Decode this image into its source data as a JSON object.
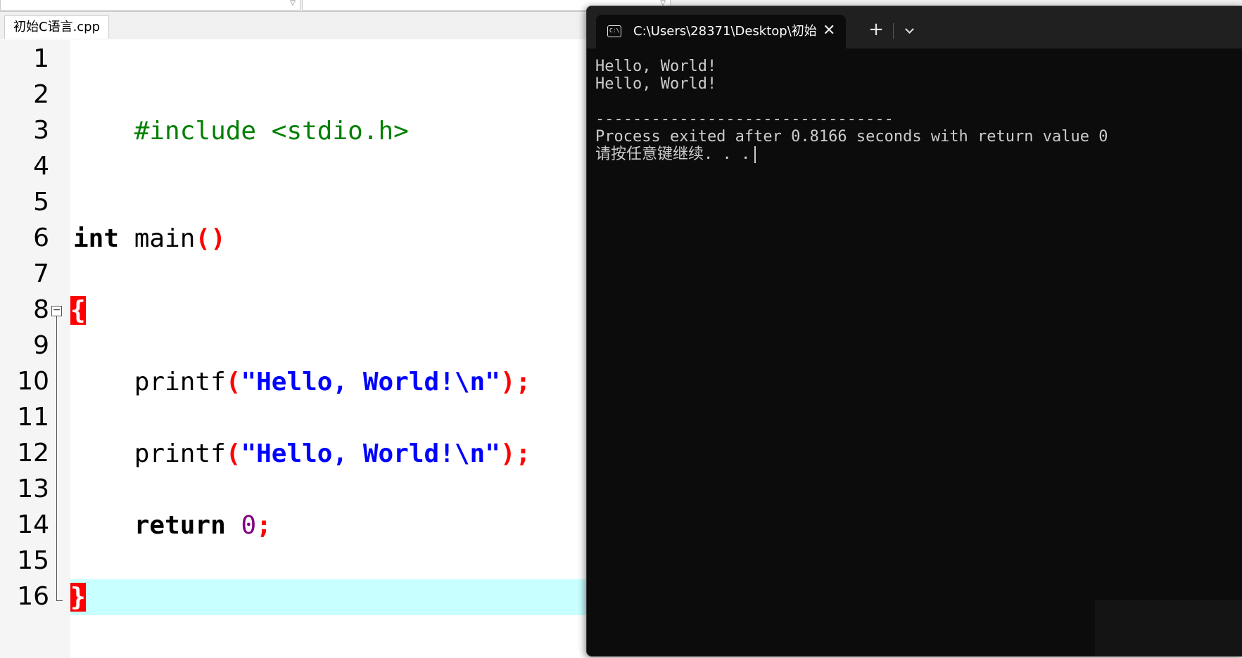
{
  "ide": {
    "file_tab": "初始C语言.cpp",
    "line_numbers": [
      "1",
      "2",
      "3",
      "4",
      "5",
      "6",
      "7",
      "8",
      "9",
      "10",
      "11",
      "12",
      "13",
      "14",
      "15",
      "16"
    ],
    "code": {
      "l2_include": "#include <stdio.h>",
      "l6_type": "int",
      "l6_name": " main",
      "l6_parens": "()",
      "l8_open_brace": "{",
      "l10_func": "printf",
      "l10_open": "(",
      "l10_str": "\"Hello, World!\\n\"",
      "l10_close": ");",
      "l12_func": "printf",
      "l12_open": "(",
      "l12_str": "\"Hello, World!\\n\"",
      "l12_close": ");",
      "l14_kw": "return",
      "l14_num": "0",
      "l14_semi": ";",
      "l16_close_brace": "}"
    },
    "fold_symbol": "−",
    "colors": {
      "preprocessor": "#008000",
      "string": "#0000ff",
      "number": "#800080",
      "symbol": "#ff0000",
      "brace_match_bg": "#ff0000",
      "current_line": "#c8ffff"
    }
  },
  "terminal": {
    "tab_icon": "terminal-icon",
    "tab_icon_text": "C:\\",
    "tab_title": "C:\\Users\\28371\\Desktop\\初始",
    "close_glyph": "✕",
    "new_tab_glyph": "+",
    "output": [
      "Hello, World!",
      "Hello, World!",
      "",
      "--------------------------------",
      "Process exited after 0.8166 seconds with return value 0",
      "请按任意键继续. . ."
    ],
    "colors": {
      "background": "#0c0c0c",
      "text": "#cccccc",
      "titlebar": "#202020"
    }
  }
}
